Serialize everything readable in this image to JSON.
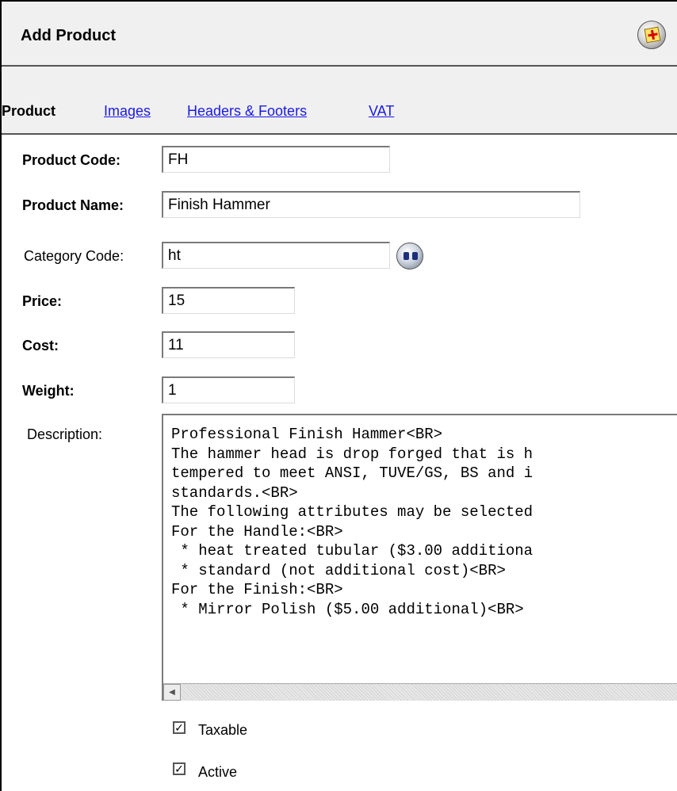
{
  "window": {
    "title": "Add Product",
    "close_icon": "close-icon"
  },
  "tabs": [
    {
      "label": "Product",
      "active": true
    },
    {
      "label": "Images",
      "active": false
    },
    {
      "label": "Headers & Footers",
      "active": false
    },
    {
      "label": "VAT",
      "active": false
    }
  ],
  "form": {
    "product_code": {
      "label": "Product Code:",
      "value": "FH"
    },
    "product_name": {
      "label": "Product Name:",
      "value": "Finish Hammer"
    },
    "category_code": {
      "label": "Category Code:",
      "value": "ht",
      "lookup_icon": "binoculars-icon"
    },
    "price": {
      "label": "Price:",
      "value": "15"
    },
    "cost": {
      "label": "Cost:",
      "value": "11"
    },
    "weight": {
      "label": "Weight:",
      "value": "1"
    },
    "description": {
      "label": "Description:",
      "value": "Professional Finish Hammer<BR>\nThe hammer head is drop forged that is h\ntempered to meet ANSI, TUVE/GS, BS and i\nstandards.<BR>\nThe following attributes may be selected\nFor the Handle:<BR>\n * heat treated tubular ($3.00 additiona\n * standard (not additional cost)<BR>\nFor the Finish:<BR>\n * Mirror Polish ($5.00 additional)<BR>"
    },
    "taxable": {
      "label": "Taxable",
      "checked": true
    },
    "active": {
      "label": "Active",
      "checked": true
    }
  },
  "colors": {
    "link": "#1a1ae6",
    "panel_bg": "#f0f0f0"
  }
}
